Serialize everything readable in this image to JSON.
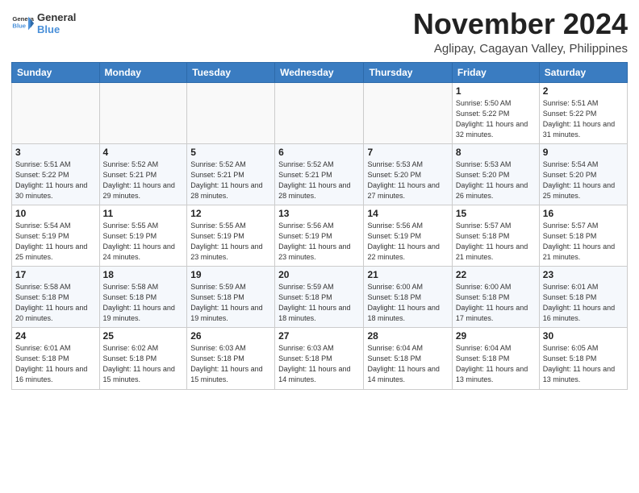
{
  "header": {
    "logo_line1": "General",
    "logo_line2": "Blue",
    "month_title": "November 2024",
    "location": "Aglipay, Cagayan Valley, Philippines"
  },
  "weekdays": [
    "Sunday",
    "Monday",
    "Tuesday",
    "Wednesday",
    "Thursday",
    "Friday",
    "Saturday"
  ],
  "weeks": [
    [
      {
        "day": "",
        "info": ""
      },
      {
        "day": "",
        "info": ""
      },
      {
        "day": "",
        "info": ""
      },
      {
        "day": "",
        "info": ""
      },
      {
        "day": "",
        "info": ""
      },
      {
        "day": "1",
        "info": "Sunrise: 5:50 AM\nSunset: 5:22 PM\nDaylight: 11 hours and 32 minutes."
      },
      {
        "day": "2",
        "info": "Sunrise: 5:51 AM\nSunset: 5:22 PM\nDaylight: 11 hours and 31 minutes."
      }
    ],
    [
      {
        "day": "3",
        "info": "Sunrise: 5:51 AM\nSunset: 5:22 PM\nDaylight: 11 hours and 30 minutes."
      },
      {
        "day": "4",
        "info": "Sunrise: 5:52 AM\nSunset: 5:21 PM\nDaylight: 11 hours and 29 minutes."
      },
      {
        "day": "5",
        "info": "Sunrise: 5:52 AM\nSunset: 5:21 PM\nDaylight: 11 hours and 28 minutes."
      },
      {
        "day": "6",
        "info": "Sunrise: 5:52 AM\nSunset: 5:21 PM\nDaylight: 11 hours and 28 minutes."
      },
      {
        "day": "7",
        "info": "Sunrise: 5:53 AM\nSunset: 5:20 PM\nDaylight: 11 hours and 27 minutes."
      },
      {
        "day": "8",
        "info": "Sunrise: 5:53 AM\nSunset: 5:20 PM\nDaylight: 11 hours and 26 minutes."
      },
      {
        "day": "9",
        "info": "Sunrise: 5:54 AM\nSunset: 5:20 PM\nDaylight: 11 hours and 25 minutes."
      }
    ],
    [
      {
        "day": "10",
        "info": "Sunrise: 5:54 AM\nSunset: 5:19 PM\nDaylight: 11 hours and 25 minutes."
      },
      {
        "day": "11",
        "info": "Sunrise: 5:55 AM\nSunset: 5:19 PM\nDaylight: 11 hours and 24 minutes."
      },
      {
        "day": "12",
        "info": "Sunrise: 5:55 AM\nSunset: 5:19 PM\nDaylight: 11 hours and 23 minutes."
      },
      {
        "day": "13",
        "info": "Sunrise: 5:56 AM\nSunset: 5:19 PM\nDaylight: 11 hours and 23 minutes."
      },
      {
        "day": "14",
        "info": "Sunrise: 5:56 AM\nSunset: 5:19 PM\nDaylight: 11 hours and 22 minutes."
      },
      {
        "day": "15",
        "info": "Sunrise: 5:57 AM\nSunset: 5:18 PM\nDaylight: 11 hours and 21 minutes."
      },
      {
        "day": "16",
        "info": "Sunrise: 5:57 AM\nSunset: 5:18 PM\nDaylight: 11 hours and 21 minutes."
      }
    ],
    [
      {
        "day": "17",
        "info": "Sunrise: 5:58 AM\nSunset: 5:18 PM\nDaylight: 11 hours and 20 minutes."
      },
      {
        "day": "18",
        "info": "Sunrise: 5:58 AM\nSunset: 5:18 PM\nDaylight: 11 hours and 19 minutes."
      },
      {
        "day": "19",
        "info": "Sunrise: 5:59 AM\nSunset: 5:18 PM\nDaylight: 11 hours and 19 minutes."
      },
      {
        "day": "20",
        "info": "Sunrise: 5:59 AM\nSunset: 5:18 PM\nDaylight: 11 hours and 18 minutes."
      },
      {
        "day": "21",
        "info": "Sunrise: 6:00 AM\nSunset: 5:18 PM\nDaylight: 11 hours and 18 minutes."
      },
      {
        "day": "22",
        "info": "Sunrise: 6:00 AM\nSunset: 5:18 PM\nDaylight: 11 hours and 17 minutes."
      },
      {
        "day": "23",
        "info": "Sunrise: 6:01 AM\nSunset: 5:18 PM\nDaylight: 11 hours and 16 minutes."
      }
    ],
    [
      {
        "day": "24",
        "info": "Sunrise: 6:01 AM\nSunset: 5:18 PM\nDaylight: 11 hours and 16 minutes."
      },
      {
        "day": "25",
        "info": "Sunrise: 6:02 AM\nSunset: 5:18 PM\nDaylight: 11 hours and 15 minutes."
      },
      {
        "day": "26",
        "info": "Sunrise: 6:03 AM\nSunset: 5:18 PM\nDaylight: 11 hours and 15 minutes."
      },
      {
        "day": "27",
        "info": "Sunrise: 6:03 AM\nSunset: 5:18 PM\nDaylight: 11 hours and 14 minutes."
      },
      {
        "day": "28",
        "info": "Sunrise: 6:04 AM\nSunset: 5:18 PM\nDaylight: 11 hours and 14 minutes."
      },
      {
        "day": "29",
        "info": "Sunrise: 6:04 AM\nSunset: 5:18 PM\nDaylight: 11 hours and 13 minutes."
      },
      {
        "day": "30",
        "info": "Sunrise: 6:05 AM\nSunset: 5:18 PM\nDaylight: 11 hours and 13 minutes."
      }
    ]
  ]
}
